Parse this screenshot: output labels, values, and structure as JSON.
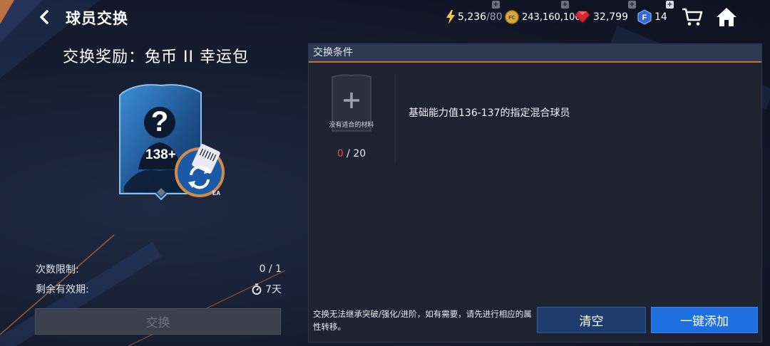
{
  "header": {
    "title": "球员交换",
    "energy": {
      "value": "5,236",
      "max": "/80"
    },
    "coins": "243,160,100",
    "gems": "32,799",
    "f_points": "14",
    "coin_icon_text": "FC"
  },
  "reward": {
    "title": "交换奖励：兔币 II 幸运包",
    "card_rating": "138+",
    "card_brand": "EA"
  },
  "limits": {
    "count_label": "次数限制:",
    "count_value": "0 / 1",
    "validity_label": "剩余有效期:",
    "validity_value": "7天"
  },
  "exchange_button": "交换",
  "conditions_panel": {
    "header": "交换条件",
    "slot_text": "没有适合的材料",
    "slot_have": "0",
    "slot_need": " / 20",
    "condition_text": "基础能力值136-137的指定混合球员",
    "note": "交换无法继承突破/强化/进阶，如有需要，请先进行相应的属性转移。",
    "clear_label": "清空",
    "add_all_label": "一键添加"
  },
  "colors": {
    "accent_orange": "#c9743a",
    "primary_blue": "#1f6fe0",
    "secondary_blue": "#1f3c6e",
    "warning_red": "#e24c4c"
  }
}
